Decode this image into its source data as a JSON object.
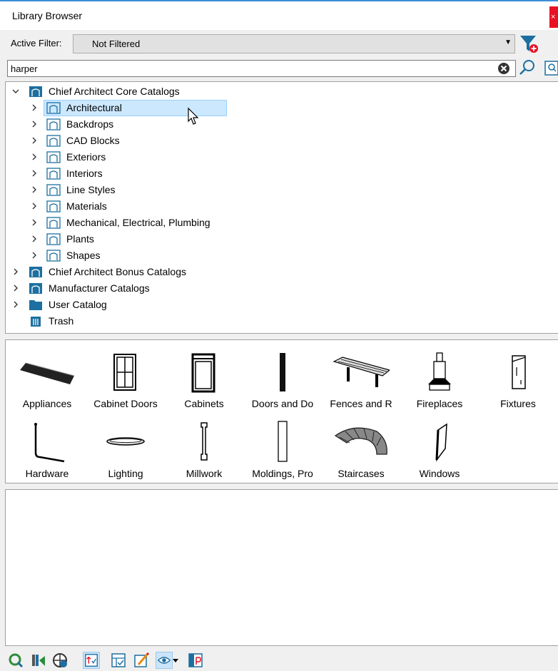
{
  "window": {
    "title": "Library Browser",
    "close": "×"
  },
  "filter": {
    "label": "Active Filter:",
    "value": "Not Filtered"
  },
  "search": {
    "value": "harper"
  },
  "tree": {
    "root1": "Chief Architect Core Catalogs",
    "children": [
      "Architectural",
      "Backdrops",
      "CAD Blocks",
      "Exteriors",
      "Interiors",
      "Line Styles",
      "Materials",
      "Mechanical, Electrical, Plumbing",
      "Plants",
      "Shapes"
    ],
    "root2": "Chief Architect Bonus Catalogs",
    "root3": "Manufacturer Catalogs",
    "root4": "User Catalog",
    "trash": "Trash",
    "selected_item": "Architectural"
  },
  "grid": {
    "row1": [
      "Appliances",
      "Cabinet Doors",
      "Cabinets",
      "Doors and Do",
      "Fences and R",
      "Fireplaces",
      "Fixtures"
    ],
    "row2": [
      "Hardware",
      "Lighting",
      "Millwork",
      "Moldings, Pro",
      "Staircases",
      "Windows"
    ]
  },
  "colors": {
    "accent": "#3c8fd8",
    "folder": "#1c6fa0",
    "selection": "#cce8ff"
  }
}
